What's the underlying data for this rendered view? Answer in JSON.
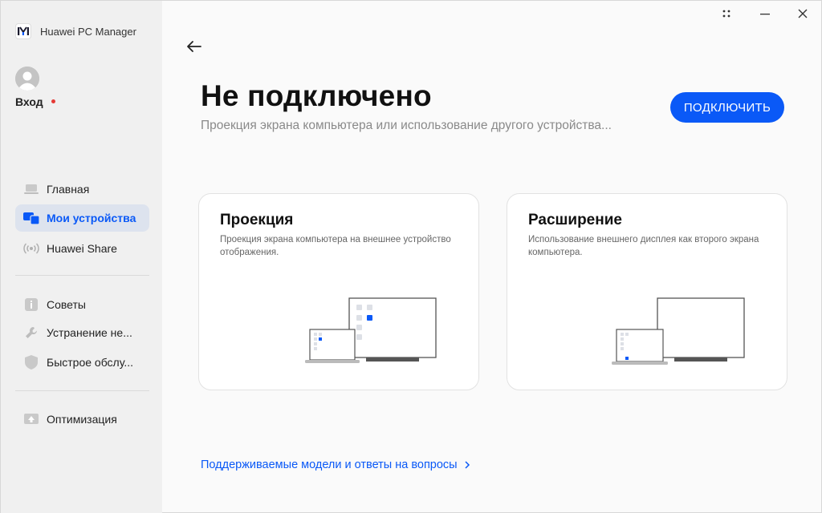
{
  "app": {
    "name": "Huawei PC Manager"
  },
  "account": {
    "login_label": "Вход",
    "notification_color": "#e53935"
  },
  "sidebar": {
    "items": [
      {
        "label": "Главная",
        "icon": "laptop-icon"
      },
      {
        "label": "Мои устройства",
        "icon": "devices-icon",
        "active": true
      },
      {
        "label": "Huawei Share",
        "icon": "share-wireless-icon"
      },
      {
        "label": "Советы",
        "icon": "tips-icon"
      },
      {
        "label": "Устранение не...",
        "icon": "wrench-icon"
      },
      {
        "label": "Быстрое обслу...",
        "icon": "shield-icon"
      },
      {
        "label": "Оптимизация",
        "icon": "optimize-icon"
      }
    ]
  },
  "main": {
    "title": "Не подключено",
    "subtitle": "Проекция экрана компьютера или использование другого устройства...",
    "connect_button": "ПОДКЛЮЧИТЬ",
    "cards": [
      {
        "title": "Проекция",
        "description": "Проекция экрана компьютера на внешнее устройство отображения."
      },
      {
        "title": "Расширение",
        "description": "Использование внешнего дисплея как второго экрана компьютера."
      }
    ],
    "faq_link": "Поддерживаемые модели и ответы на вопросы"
  },
  "colors": {
    "accent": "#0a59f7",
    "sidebar_bg": "#f0f0f0",
    "active_bg": "#dde3ee"
  }
}
